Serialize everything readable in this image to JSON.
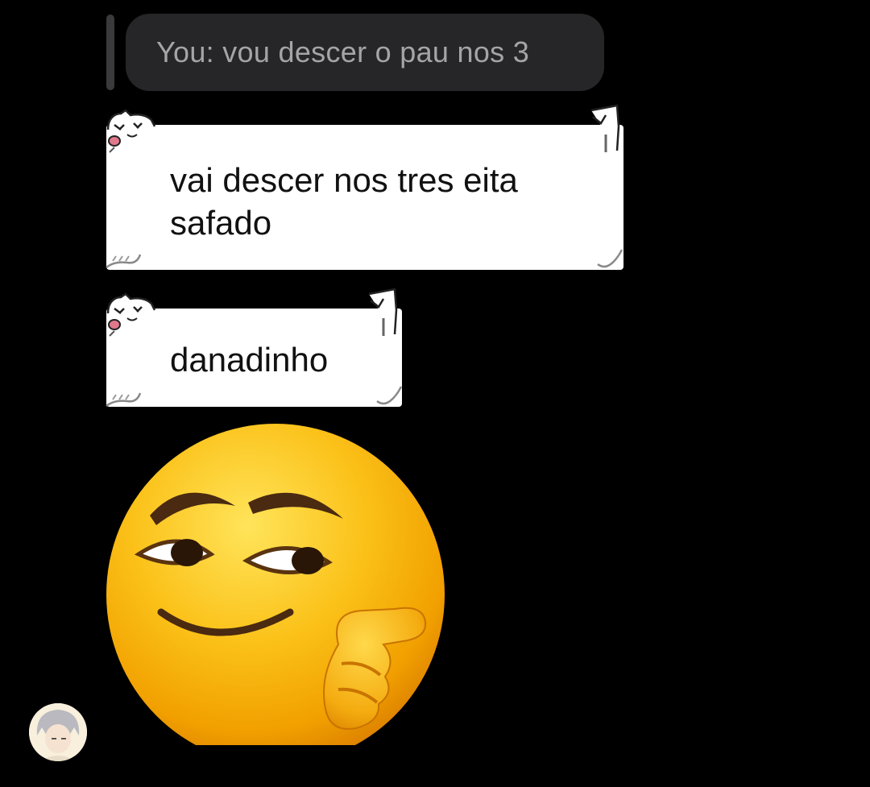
{
  "reply": {
    "text": "You: vou descer o pau nos 3"
  },
  "messages": [
    {
      "line1": "vai descer nos tres eita",
      "line2": "safado"
    },
    {
      "line1": "danadinho"
    }
  ],
  "sticker": {
    "icon": "smirking-face-pointing-emoji"
  },
  "avatar": {
    "icon": "anime-profile-avatar"
  },
  "colors": {
    "background": "#000000",
    "reply_bubble": "#262628",
    "reply_text": "#a5a5a8",
    "bubble": "#ffffff",
    "emoji_yellow": "#f5b400"
  }
}
